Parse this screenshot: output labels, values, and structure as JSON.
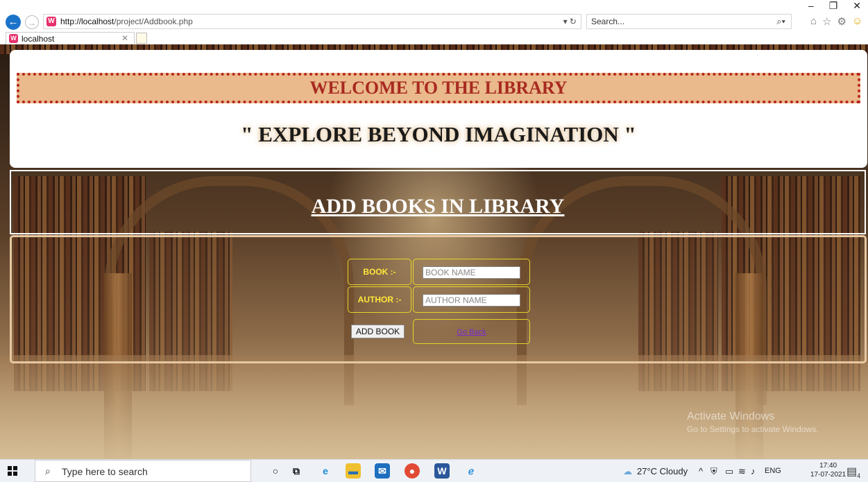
{
  "browser": {
    "url_host": "http://localhost",
    "url_path": "/project/Addbook.php",
    "search_placeholder": "Search...",
    "tab_title": "localhost",
    "window_controls": [
      "–",
      "❐",
      "✕"
    ]
  },
  "header": {
    "welcome": "WELCOME TO THE LIBRARY",
    "tagline": "\" EXPLORE BEYOND IMAGINATION \""
  },
  "page": {
    "title": "ADD BOOKS IN LIBRARY"
  },
  "form": {
    "book_label": "BOOK :-",
    "book_placeholder": "BOOK NAME",
    "author_label": "AUTHOR :-",
    "author_placeholder": "AUTHOR NAME",
    "submit_label": "ADD BOOK",
    "back_link": "Go Back"
  },
  "watermark": {
    "line1": "Activate Windows",
    "line2": "Go to Settings to activate Windows."
  },
  "taskbar": {
    "search_placeholder": "Type here to search",
    "weather": "27°C  Cloudy",
    "language": "ENG",
    "time": "17:40",
    "date": "17-07-2021",
    "notification_count": "4"
  },
  "colors": {
    "welcome_bg": "#eab98c",
    "welcome_text": "#a82a20",
    "form_label": "#ffe83a",
    "link": "#7a2bd0"
  }
}
